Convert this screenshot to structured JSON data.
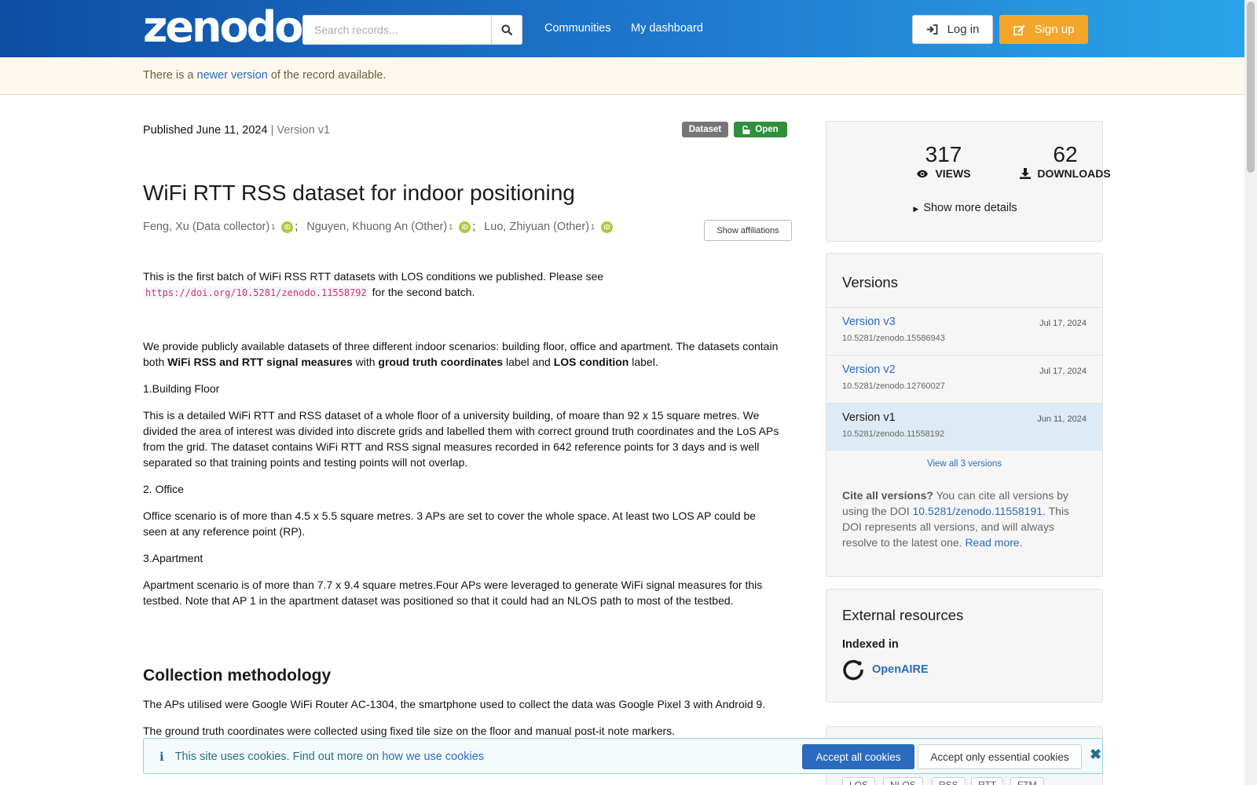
{
  "header": {
    "logo": "zenodo",
    "search_placeholder": "Search records...",
    "nav": [
      "Communities",
      "My dashboard"
    ],
    "login_label": "Log in",
    "signup_label": "Sign up"
  },
  "banner": {
    "prefix": "There is a",
    "link": "newer version",
    "suffix": "of the record available."
  },
  "record": {
    "published": "Published June 11, 2024",
    "version": "| Version v1",
    "badge_type": "Dataset",
    "badge_access": "Open",
    "title": "WiFi RTT RSS dataset for indoor positioning",
    "authors": [
      {
        "name": "Feng, Xu (Data collector)",
        "aff": "1"
      },
      {
        "name": "Nguyen, Khuong An (Other)",
        "aff": "1"
      },
      {
        "name": "Luo, Zhiyuan (Other)",
        "aff": "1"
      }
    ],
    "show_affiliations": "Show affiliations"
  },
  "description": {
    "p1_text": "This is the first batch of WiFi RSS RTT datasets with LOS conditions we published. Please see",
    "p1_code": "https://doi.org/10.5281/zenodo.11558792",
    "p1_suffix": "for the second batch.",
    "p2_a": "We provide publicly available datasets of three different indoor scenarios: building floor, office and apartment. The datasets contain both",
    "p2_b1": "WiFi RSS and RTT signal measures",
    "p2_c": "with",
    "p2_b2": "groud truth coordinates",
    "p2_d": "label and",
    "p2_b3": "LOS condition",
    "p2_e": "label.",
    "h_building": "1.Building Floor",
    "p_building": "This is a detailed WiFi RTT and RSS dataset of a whole floor of a university building, of moare than 92 x 15 square metres. We divided the area of interest was divided into discrete grids and labelled them with correct ground truth coordinates and the LoS APs from the grid. The dataset contains WiFi RTT and RSS signal measures recorded in 642 reference points for 3 days and is well separated so that training points and testing points will not overlap.",
    "h_office": "2. Office",
    "p_office": "Office scenario is of more than 4.5 x 5.5 square metres. 3 APs are set to cover the whole space. At least two LOS AP could be seen at any reference point (RP).",
    "h_apartment": "3.Apartment",
    "p_apartment": "Apartment scenario is of more than 7.7 x 9.4 square metres.Four APs were leveraged to generate WiFi signal measures for this testbed. Note that AP 1 in the apartment dataset was positioned so that it could had an NLOS path to most of the testbed.",
    "method_heading": "Collection methodology",
    "method_p1": "The APs utilised were Google WiFi Router AC-1304, the smartphone used to collect the data was Google Pixel 3 with Android 9.",
    "method_p2": "The ground truth coordinates were collected using fixed tile size on the floor and manual post-it note markers."
  },
  "stats": {
    "views": "317",
    "views_label": "VIEWS",
    "downloads": "62",
    "downloads_label": "DOWNLOADS",
    "more_details": "Show more details"
  },
  "versions": {
    "title": "Versions",
    "items": [
      {
        "name": "Version v3",
        "date": "Jul 17, 2024",
        "doi": "10.5281/zenodo.15586943"
      },
      {
        "name": "Version v2",
        "date": "Jul 17, 2024",
        "doi": "10.5281/zenodo.12760027"
      },
      {
        "name": "Version v1",
        "date": "Jun 11, 2024",
        "doi": "10.5281/zenodo.11558192"
      }
    ],
    "view_all": "View all 3 versions",
    "cite_bold": "Cite all versions?",
    "cite_a": "You can cite all versions by using the DOI",
    "cite_doi": "10.5281/zenodo.11558191",
    "cite_b": ". This DOI represents all versions, and will always resolve to the latest one.",
    "read_more": "Read more."
  },
  "external": {
    "title": "External resources",
    "indexed_in": "Indexed in",
    "openaire": "OpenAIRE"
  },
  "keywords": [
    "LOS",
    "NLOS",
    "RSS",
    "RTT",
    "FTM"
  ],
  "cookie": {
    "text": "This site uses cookies. Find out more on",
    "link": "how we use cookies",
    "accept_all": "Accept all cookies",
    "accept_essential": "Accept only essential cookies"
  }
}
